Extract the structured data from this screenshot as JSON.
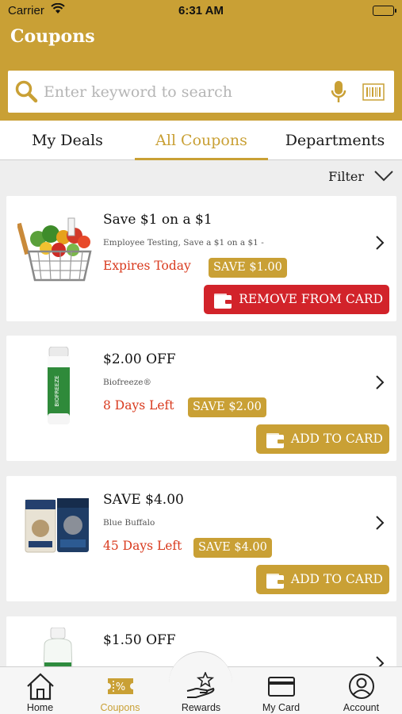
{
  "status_bar": {
    "carrier": "Carrier",
    "time": "6:31 AM"
  },
  "header": {
    "title": "Coupons"
  },
  "search": {
    "placeholder": "Enter keyword to search"
  },
  "tabs": [
    {
      "label": "My Deals"
    },
    {
      "label": "All Coupons",
      "active": true
    },
    {
      "label": "Departments"
    }
  ],
  "filter": {
    "label": "Filter"
  },
  "coupons": [
    {
      "title": "Save $1 on a $1",
      "subtitle": "Employee Testing, Save a $1 on a $1 -",
      "expiry": "Expires Today",
      "save": "SAVE $1.00",
      "action": "REMOVE FROM CARD",
      "image": "grocery-basket"
    },
    {
      "title": "$2.00 OFF",
      "subtitle": "Biofreeze®",
      "expiry": "8 Days Left",
      "save": "SAVE $2.00",
      "action": "ADD TO CARD",
      "image": "biofreeze-bottle"
    },
    {
      "title": "SAVE $4.00",
      "subtitle": "Blue Buffalo",
      "expiry": "45 Days Left",
      "save": "SAVE $4.00",
      "action": "ADD TO CARD",
      "image": "dog-food-bags"
    },
    {
      "title": "$1.50 OFF",
      "subtitle": "",
      "expiry": "",
      "save": "",
      "action": "",
      "image": "spray-bottle"
    }
  ],
  "tabbar": [
    {
      "label": "Home",
      "icon": "home-icon"
    },
    {
      "label": "Coupons",
      "icon": "coupon-icon",
      "active": true
    },
    {
      "label": "Rewards",
      "icon": "rewards-icon"
    },
    {
      "label": "My Card",
      "icon": "card-icon"
    },
    {
      "label": "Account",
      "icon": "account-icon"
    }
  ],
  "colors": {
    "brand": "#c9a035",
    "remove": "#d2232a",
    "expiry": "#d93a1e"
  }
}
